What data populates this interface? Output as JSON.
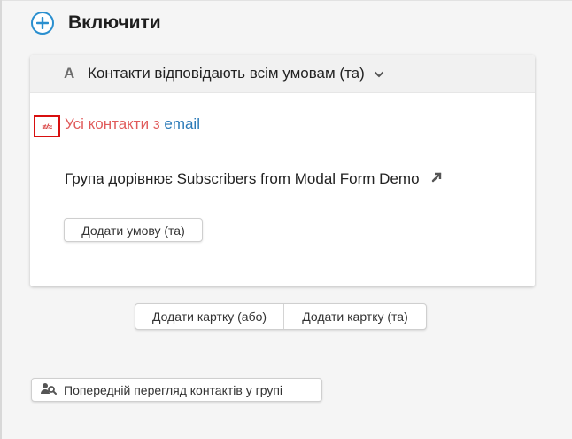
{
  "section": {
    "title": "Включити"
  },
  "card": {
    "letter": "A",
    "match_label": "Контакти відповідають всім умовам (та)",
    "condition_icon_text": "≠/≈",
    "conditions": {
      "all_contacts_prefix": "Усі контакти з",
      "all_contacts_link": "email",
      "group_condition": "Група дорівнює Subscribers from Modal Form Demo"
    },
    "add_condition_label": "Додати умову (та)"
  },
  "add_card": {
    "or_label": "Додати картку (або)",
    "and_label": "Додати картку (та)"
  },
  "preview": {
    "label": "Попередній перегляд контактів у групі"
  },
  "colors": {
    "accent": "#2a8fcf",
    "condition_red": "#e05b5b",
    "link_blue": "#2a7ab8",
    "highlight_border": "#d80f0f"
  },
  "icons": {
    "plus": "plus-circle-icon",
    "chevron": "chevron-down-icon",
    "external": "external-link-icon",
    "preview": "user-search-icon"
  }
}
